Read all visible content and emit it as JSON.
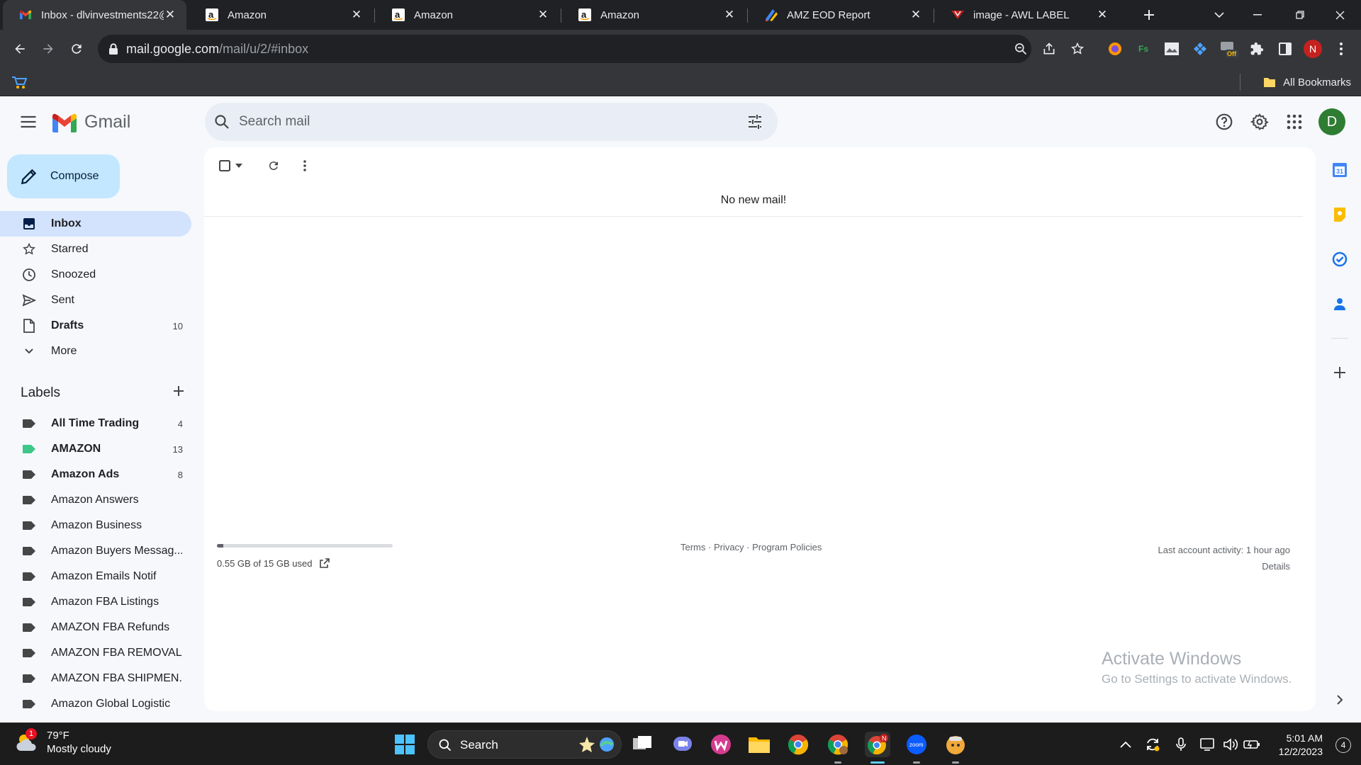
{
  "browser": {
    "tabs": [
      {
        "title": "Inbox - dlvinvestments22@",
        "icon": "gmail-icon",
        "active": true
      },
      {
        "title": "Amazon",
        "icon": "amazon-icon",
        "active": false
      },
      {
        "title": "Amazon",
        "icon": "amazon-icon",
        "active": false
      },
      {
        "title": "Amazon",
        "icon": "amazon-icon",
        "active": false
      },
      {
        "title": "AMZ EOD Report",
        "icon": "report-icon",
        "active": false
      },
      {
        "title": "image - AWL LABEL",
        "icon": "awl-icon",
        "active": false
      }
    ],
    "url_host": "mail.google.com",
    "url_path": "/mail/u/2/#inbox",
    "profile_initial": "N",
    "bookmarks_label": "All Bookmarks"
  },
  "gmail": {
    "app_name": "Gmail",
    "search_placeholder": "Search mail",
    "account_initial": "D",
    "compose_label": "Compose",
    "nav": [
      {
        "label": "Inbox",
        "count": "",
        "icon": "inbox-icon",
        "active": true,
        "bold": true
      },
      {
        "label": "Starred",
        "count": "",
        "icon": "star-icon",
        "active": false,
        "bold": false
      },
      {
        "label": "Snoozed",
        "count": "",
        "icon": "clock-icon",
        "active": false,
        "bold": false
      },
      {
        "label": "Sent",
        "count": "",
        "icon": "send-icon",
        "active": false,
        "bold": false
      },
      {
        "label": "Drafts",
        "count": "10",
        "icon": "draft-icon",
        "active": false,
        "bold": true
      },
      {
        "label": "More",
        "count": "",
        "icon": "chevron-down-icon",
        "active": false,
        "bold": false
      }
    ],
    "labels_heading": "Labels",
    "labels": [
      {
        "name": "All Time Trading",
        "count": "4",
        "bold": true,
        "color": "#444746"
      },
      {
        "name": "AMAZON",
        "count": "13",
        "bold": true,
        "color": "#3dc789"
      },
      {
        "name": "Amazon Ads",
        "count": "8",
        "bold": true,
        "color": "#444746"
      },
      {
        "name": "Amazon Answers",
        "count": "",
        "bold": false,
        "color": "#444746"
      },
      {
        "name": "Amazon Business",
        "count": "",
        "bold": false,
        "color": "#444746"
      },
      {
        "name": "Amazon Buyers Messag...",
        "count": "",
        "bold": false,
        "color": "#444746"
      },
      {
        "name": "Amazon Emails Notif",
        "count": "",
        "bold": false,
        "color": "#444746"
      },
      {
        "name": "Amazon FBA Listings",
        "count": "",
        "bold": false,
        "color": "#444746"
      },
      {
        "name": "AMAZON FBA Refunds",
        "count": "",
        "bold": false,
        "color": "#444746"
      },
      {
        "name": "AMAZON FBA REMOVAL",
        "count": "",
        "bold": false,
        "color": "#444746"
      },
      {
        "name": "AMAZON FBA SHIPMEN...",
        "count": "",
        "bold": false,
        "color": "#444746"
      },
      {
        "name": "Amazon Global Logistic",
        "count": "",
        "bold": false,
        "color": "#444746"
      }
    ],
    "empty_message": "No new mail!",
    "storage_text": "0.55 GB of 15 GB used",
    "storage_fraction": 0.0367,
    "footer_links": "Terms · Privacy · Program Policies",
    "last_activity": "Last account activity: 1 hour ago",
    "details_link": "Details"
  },
  "windows_watermark": {
    "title": "Activate Windows",
    "subtitle": "Go to Settings to activate Windows."
  },
  "taskbar": {
    "weather_badge": "1",
    "temperature": "79°F",
    "condition": "Mostly cloudy",
    "search_label": "Search",
    "time": "5:01 AM",
    "date": "12/2/2023",
    "notification_count": "4"
  }
}
